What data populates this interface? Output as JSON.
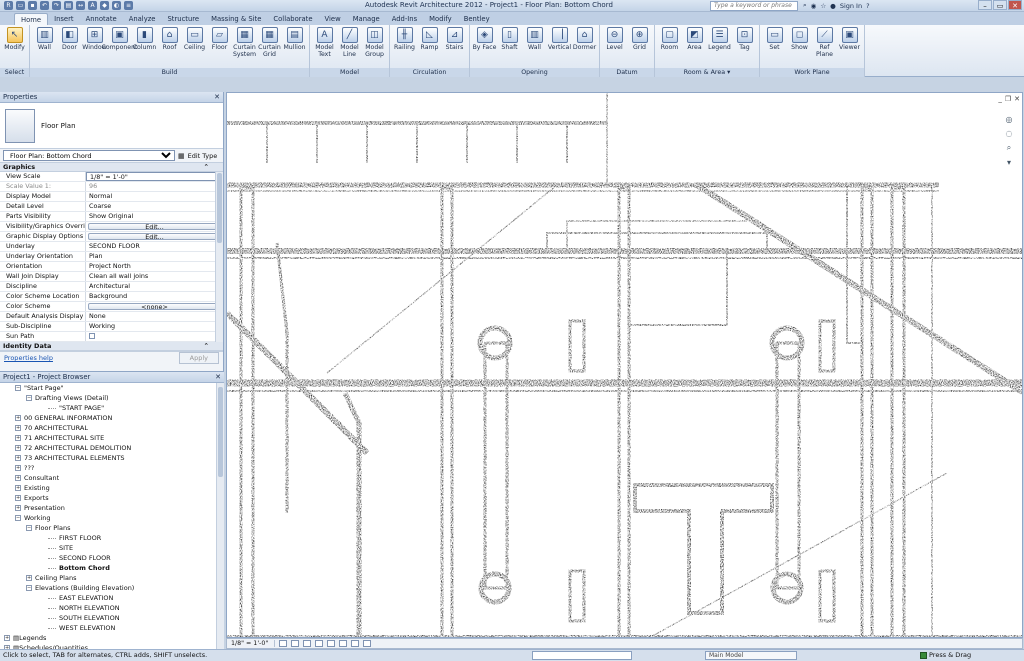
{
  "app": {
    "title": "Autodesk Revit Architecture 2012 -    Project1 - Floor Plan: Bottom Chord",
    "search_placeholder": "Type a keyword or phrase",
    "sign_in": "Sign In"
  },
  "tabs": [
    "Home",
    "Insert",
    "Annotate",
    "Analyze",
    "Structure",
    "Massing & Site",
    "Collaborate",
    "View",
    "Manage",
    "Add-Ins",
    "Modify",
    "Bentley"
  ],
  "ribbon": {
    "select": {
      "label": "Select",
      "tools": [
        {
          "label": "Modify",
          "icon": "pointer-icon"
        }
      ]
    },
    "build": {
      "label": "Build",
      "tools": [
        {
          "label": "Wall",
          "icon": "wall-icon"
        },
        {
          "label": "Door",
          "icon": "door-icon"
        },
        {
          "label": "Window",
          "icon": "window-icon"
        },
        {
          "label": "Component",
          "icon": "component-icon"
        },
        {
          "label": "Column",
          "icon": "column-icon"
        },
        {
          "label": "Roof",
          "icon": "roof-icon"
        },
        {
          "label": "Ceiling",
          "icon": "ceiling-icon"
        },
        {
          "label": "Floor",
          "icon": "floor-icon"
        },
        {
          "label": "Curtain System",
          "icon": "curtain-system-icon"
        },
        {
          "label": "Curtain Grid",
          "icon": "curtain-grid-icon"
        },
        {
          "label": "Mullion",
          "icon": "mullion-icon"
        }
      ]
    },
    "model": {
      "label": "Model",
      "tools": [
        {
          "label": "Model Text",
          "icon": "model-text-icon"
        },
        {
          "label": "Model Line",
          "icon": "model-line-icon"
        },
        {
          "label": "Model Group",
          "icon": "model-group-icon"
        }
      ]
    },
    "circulation": {
      "label": "Circulation",
      "tools": [
        {
          "label": "Railing",
          "icon": "railing-icon"
        },
        {
          "label": "Ramp",
          "icon": "ramp-icon"
        },
        {
          "label": "Stairs",
          "icon": "stairs-icon"
        }
      ]
    },
    "opening": {
      "label": "Opening",
      "tools": [
        {
          "label": "By Face",
          "icon": "by-face-icon"
        },
        {
          "label": "Shaft",
          "icon": "shaft-icon"
        },
        {
          "label": "Wall",
          "icon": "wall-opening-icon"
        },
        {
          "label": "Vertical",
          "icon": "vertical-icon"
        },
        {
          "label": "Dormer",
          "icon": "dormer-icon"
        }
      ]
    },
    "datum": {
      "label": "Datum",
      "tools": [
        {
          "label": "Level",
          "icon": "level-icon"
        },
        {
          "label": "Grid",
          "icon": "grid-icon"
        }
      ]
    },
    "room_area": {
      "label": "Room & Area ▾",
      "tools": [
        {
          "label": "Room",
          "icon": "room-icon"
        },
        {
          "label": "Area",
          "icon": "area-icon"
        },
        {
          "label": "Legend",
          "icon": "legend-icon"
        },
        {
          "label": "Tag",
          "icon": "tag-icon"
        }
      ]
    },
    "work_plane": {
      "label": "Work Plane",
      "tools": [
        {
          "label": "Set",
          "icon": "set-icon"
        },
        {
          "label": "Show",
          "icon": "show-icon"
        },
        {
          "label": "Ref Plane",
          "icon": "ref-plane-icon"
        },
        {
          "label": "Viewer",
          "icon": "viewer-icon"
        }
      ]
    }
  },
  "properties": {
    "header": "Properties",
    "type_name": "Floor Plan",
    "selector": "Floor Plan: Bottom Chord",
    "edit_type": "Edit Type",
    "sections": [
      {
        "name": "Graphics",
        "rows": [
          {
            "k": "View Scale",
            "v": "1/8\" = 1'-0\"",
            "kind": "input"
          },
          {
            "k": "Scale Value    1:",
            "v": "96",
            "kind": "grey"
          },
          {
            "k": "Display Model",
            "v": "Normal"
          },
          {
            "k": "Detail Level",
            "v": "Coarse"
          },
          {
            "k": "Parts Visibility",
            "v": "Show Original"
          },
          {
            "k": "Visibility/Graphics Overri...",
            "v": "Edit...",
            "kind": "btn"
          },
          {
            "k": "Graphic Display Options",
            "v": "Edit...",
            "kind": "btn"
          },
          {
            "k": "Underlay",
            "v": "SECOND FLOOR"
          },
          {
            "k": "Underlay Orientation",
            "v": "Plan"
          },
          {
            "k": "Orientation",
            "v": "Project North"
          },
          {
            "k": "Wall Join Display",
            "v": "Clean all wall joins"
          },
          {
            "k": "Discipline",
            "v": "Architectural"
          },
          {
            "k": "Color Scheme Location",
            "v": "Background"
          },
          {
            "k": "Color Scheme",
            "v": "<none>",
            "kind": "btn"
          },
          {
            "k": "Default Analysis Display ...",
            "v": "None"
          },
          {
            "k": "Sub-Discipline",
            "v": "Working"
          },
          {
            "k": "Sun Path",
            "v": "",
            "kind": "check"
          }
        ]
      },
      {
        "name": "Identity Data",
        "rows": [
          {
            "k": "View Name",
            "v": "Bottom Chord"
          }
        ]
      }
    ],
    "help_link": "Properties help",
    "apply": "Apply"
  },
  "browser": {
    "header": "Project1 - Project Browser",
    "items": [
      {
        "label": "\"Start Page\"",
        "indent": 1,
        "exp": "-"
      },
      {
        "label": "Drafting Views (Detail)",
        "indent": 2,
        "exp": "-"
      },
      {
        "label": "\"START PAGE\"",
        "indent": 4,
        "exp": ""
      },
      {
        "label": "00 GENERAL INFORMATION",
        "indent": 1,
        "exp": "+"
      },
      {
        "label": "70 ARCHITECTURAL",
        "indent": 1,
        "exp": "+"
      },
      {
        "label": "71 ARCHITECTURAL SITE",
        "indent": 1,
        "exp": "+"
      },
      {
        "label": "72 ARCHITECTURAL DEMOLITION",
        "indent": 1,
        "exp": "+"
      },
      {
        "label": "73 ARCHITECTURAL ELEMENTS",
        "indent": 1,
        "exp": "+"
      },
      {
        "label": "???",
        "indent": 1,
        "exp": "+"
      },
      {
        "label": "Consultant",
        "indent": 1,
        "exp": "+"
      },
      {
        "label": "Existing",
        "indent": 1,
        "exp": "+"
      },
      {
        "label": "Exports",
        "indent": 1,
        "exp": "+"
      },
      {
        "label": "Presentation",
        "indent": 1,
        "exp": "+"
      },
      {
        "label": "Working",
        "indent": 1,
        "exp": "-"
      },
      {
        "label": "Floor Plans",
        "indent": 2,
        "exp": "-"
      },
      {
        "label": "FIRST FLOOR",
        "indent": 4,
        "exp": ""
      },
      {
        "label": "SITE",
        "indent": 4,
        "exp": ""
      },
      {
        "label": "SECOND FLOOR",
        "indent": 4,
        "exp": ""
      },
      {
        "label": "Bottom Chord",
        "indent": 4,
        "exp": "",
        "bold": true
      },
      {
        "label": "Ceiling Plans",
        "indent": 2,
        "exp": "+"
      },
      {
        "label": "Elevations (Building Elevation)",
        "indent": 2,
        "exp": "-"
      },
      {
        "label": "EAST ELEVATION",
        "indent": 4,
        "exp": ""
      },
      {
        "label": "NORTH ELEVATION",
        "indent": 4,
        "exp": ""
      },
      {
        "label": "SOUTH ELEVATION",
        "indent": 4,
        "exp": ""
      },
      {
        "label": "WEST ELEVATION",
        "indent": 4,
        "exp": ""
      },
      {
        "label": "Legends",
        "indent": 0,
        "exp": "+"
      },
      {
        "label": "Schedules/Quantities",
        "indent": 0,
        "exp": "+"
      }
    ]
  },
  "view_control": {
    "scale": "1/8\" = 1'-0\""
  },
  "status": {
    "message": "Click to select, TAB for alternates, CTRL adds, SHIFT unselects.",
    "model": "Main Model",
    "press_drag": "Press & Drag"
  }
}
